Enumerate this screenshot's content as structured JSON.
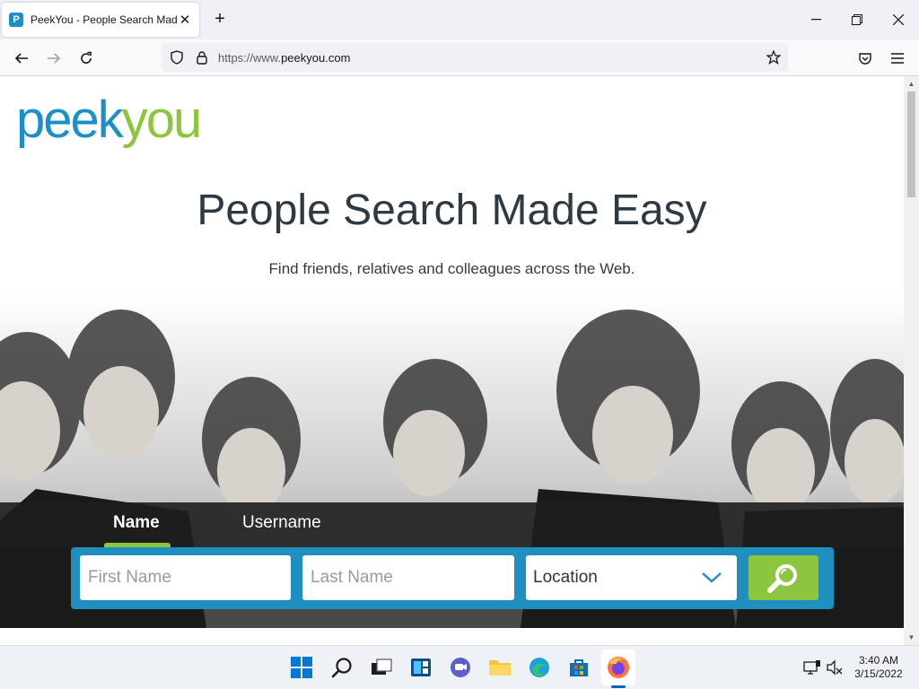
{
  "browser": {
    "tab_title": "PeekYou - People Search Made Easy",
    "favicon_letter": "P",
    "url_prefix": "https://www.",
    "url_domain": "peekyou.com"
  },
  "page": {
    "logo_peek": "peek",
    "logo_you": "you",
    "headline": "People Search Made Easy",
    "subline": "Find friends, relatives and colleagues across the Web.",
    "search_tabs": [
      {
        "label": "Name",
        "active": true
      },
      {
        "label": "Username",
        "active": false
      }
    ],
    "first_name_placeholder": "First Name",
    "last_name_placeholder": "Last Name",
    "location_value": "Location"
  },
  "taskbar": {
    "time": "3:40 AM",
    "date": "3/15/2022"
  },
  "colors": {
    "brand_blue": "#1a8fc9",
    "brand_green": "#8cc63f",
    "search_panel": "#1f8fc0"
  }
}
